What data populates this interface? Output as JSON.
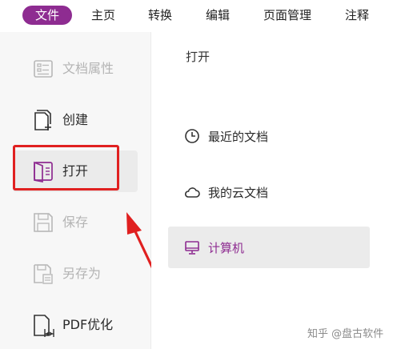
{
  "tabs": [
    {
      "label": "文件",
      "active": true
    },
    {
      "label": "主页"
    },
    {
      "label": "转换"
    },
    {
      "label": "编辑"
    },
    {
      "label": "页面管理"
    },
    {
      "label": "注释"
    }
  ],
  "sidebar": {
    "items": [
      {
        "label": "文档属性",
        "icon": "document-properties-icon",
        "state": "disabled"
      },
      {
        "label": "创建",
        "icon": "create-document-icon",
        "state": "enabled"
      },
      {
        "label": "打开",
        "icon": "open-book-icon",
        "state": "selected"
      },
      {
        "label": "保存",
        "icon": "save-icon",
        "state": "disabled"
      },
      {
        "label": "另存为",
        "icon": "save-as-icon",
        "state": "disabled"
      },
      {
        "label": "PDF优化",
        "icon": "pdf-optimize-icon",
        "state": "enabled"
      }
    ]
  },
  "open_panel": {
    "title": "打开",
    "locations": [
      {
        "label": "最近的文档",
        "icon": "clock-icon"
      },
      {
        "label": "我的云文档",
        "icon": "cloud-icon"
      },
      {
        "label": "计算机",
        "icon": "computer-icon",
        "active": true
      }
    ]
  },
  "watermark": "知乎 @盘古软件",
  "colors": {
    "accent": "#8e2c91",
    "highlight_box": "#e02020",
    "sidebar_bg": "#f7f7f7",
    "selected_bg": "#ebebeb"
  }
}
